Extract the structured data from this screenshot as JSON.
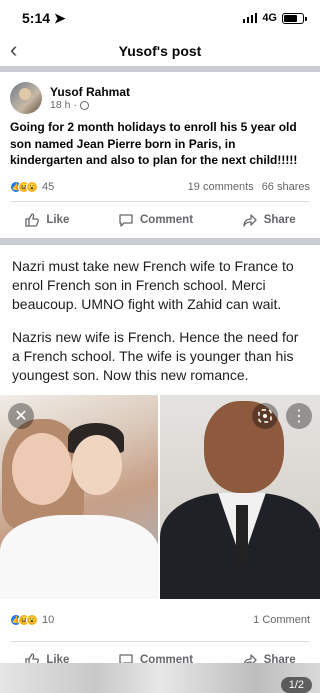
{
  "status": {
    "time": "5:14",
    "network": "4G"
  },
  "header": {
    "title": "Yusof's post"
  },
  "post": {
    "author": "Yusof Rahmat",
    "time": "18 h",
    "text": "Going for 2 month holidays to enroll his 5 year old son named Jean Pierre born in Paris, in kindergarten and also to plan for the next child!!!!!",
    "reaction_count": "45",
    "comments": "19 comments",
    "shares": "66 shares"
  },
  "actions": {
    "like": "Like",
    "comment": "Comment",
    "share": "Share"
  },
  "comment": {
    "text1": "Nazri must take new French wife to France to enrol French son in French school. Merci beaucoup. UMNO fight with Zahid can wait.",
    "text2": "Nazris new wife is French. Hence the need for a French school. The wife is younger than his youngest son. Now this new romance.",
    "reaction_count": "10",
    "comments": "1 Comment"
  },
  "bottom": {
    "page_indicator": "1/2"
  },
  "colors": {
    "accent": "#1877f2",
    "divider": "#c9ccd1",
    "muted": "#65676b"
  }
}
